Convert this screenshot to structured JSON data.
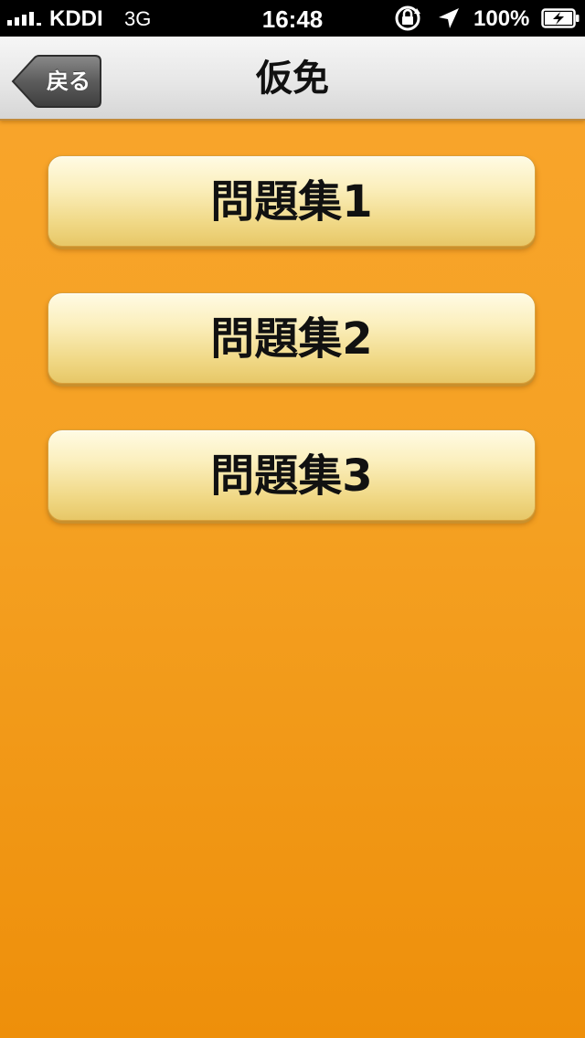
{
  "status_bar": {
    "carrier": "KDDI",
    "network": "3G",
    "time": "16:48",
    "battery_percent": "100%",
    "icons": [
      "signal-icon",
      "rotation-lock-icon",
      "location-icon",
      "battery-charging-icon"
    ]
  },
  "nav": {
    "title": "仮免",
    "back_label": "戻る"
  },
  "menu": {
    "items": [
      {
        "label": "問題集1"
      },
      {
        "label": "問題集2"
      },
      {
        "label": "問題集3"
      }
    ]
  },
  "colors": {
    "background_top": "#f9a52c",
    "background_bottom": "#ee8f0a",
    "button_top": "#fffbe4",
    "button_bottom": "#e7c767"
  }
}
